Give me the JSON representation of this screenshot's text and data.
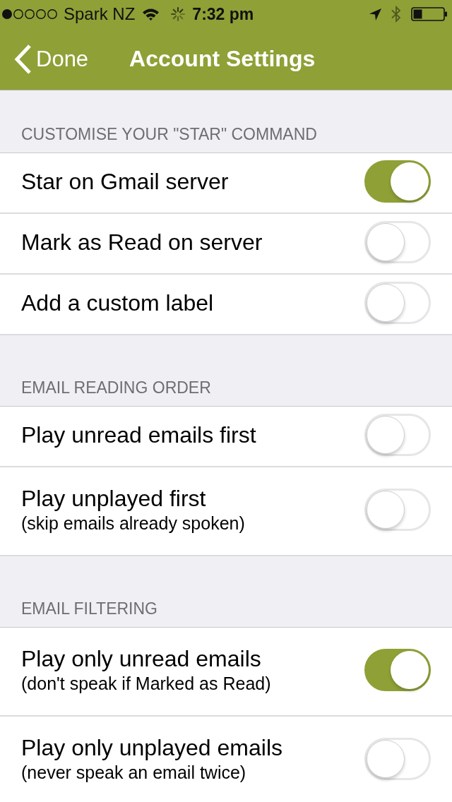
{
  "status_bar": {
    "carrier": "Spark NZ",
    "time": "7:32 pm"
  },
  "nav_bar": {
    "back_label": "Done",
    "title": "Account Settings"
  },
  "sections": [
    {
      "header": "CUSTOMISE YOUR \"STAR\" COMMAND",
      "rows": [
        {
          "label": "Star on Gmail server",
          "on": true
        },
        {
          "label": "Mark as Read on server",
          "on": false
        },
        {
          "label": "Add a custom label",
          "on": false
        }
      ]
    },
    {
      "header": "EMAIL READING ORDER",
      "rows": [
        {
          "label": "Play unread emails first",
          "on": false
        },
        {
          "label": "Play unplayed first",
          "subtitle": "(skip emails already spoken)",
          "on": false
        }
      ]
    },
    {
      "header": "EMAIL FILTERING",
      "rows": [
        {
          "label": "Play only unread emails",
          "subtitle": "(don't speak if Marked as Read)",
          "on": true
        },
        {
          "label": "Play only unplayed emails",
          "subtitle": "(never speak an email twice)",
          "on": false
        }
      ]
    }
  ]
}
